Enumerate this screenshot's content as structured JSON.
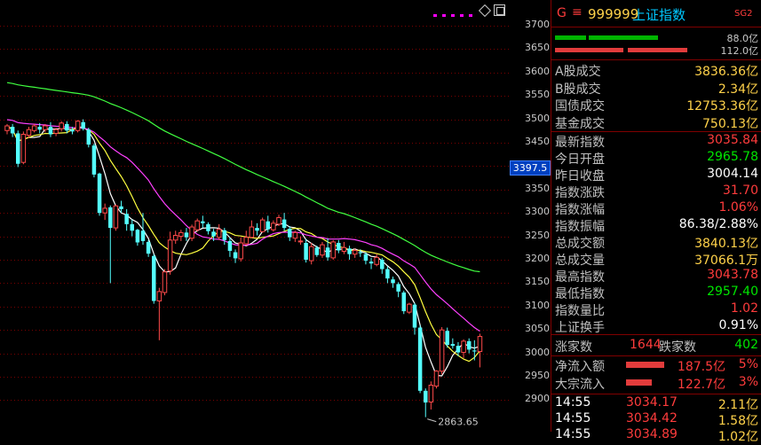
{
  "chart_data": {
    "type": "candlestick",
    "ylim": [
      2850,
      3720
    ],
    "price_ticks": [
      "3700",
      "3650",
      "3600",
      "3550",
      "3500",
      "3450",
      "3400",
      "3350",
      "3300",
      "3250",
      "3200",
      "3150",
      "3100",
      "3050",
      "3000",
      "2950",
      "2900"
    ],
    "current_price_label": "3397.5",
    "low_annotation": "2863.65",
    "candles": [
      [
        3476,
        3486,
        3468,
        3490
      ],
      [
        3484,
        3470,
        3462,
        3490
      ],
      [
        3470,
        3405,
        3398,
        3476
      ],
      [
        3408,
        3468,
        3404,
        3474
      ],
      [
        3466,
        3478,
        3460,
        3484
      ],
      [
        3476,
        3486,
        3472,
        3490
      ],
      [
        3484,
        3478,
        3470,
        3492
      ],
      [
        3478,
        3486,
        3472,
        3490
      ],
      [
        3484,
        3468,
        3462,
        3494
      ],
      [
        3470,
        3478,
        3464,
        3482
      ],
      [
        3480,
        3492,
        3474,
        3496
      ],
      [
        3490,
        3476,
        3470,
        3496
      ],
      [
        3478,
        3474,
        3468,
        3484
      ],
      [
        3476,
        3496,
        3472,
        3498
      ],
      [
        3494,
        3480,
        3476,
        3500
      ],
      [
        3478,
        3446,
        3440,
        3482
      ],
      [
        3444,
        3382,
        3376,
        3448
      ],
      [
        3384,
        3300,
        3294,
        3386
      ],
      [
        3300,
        3310,
        3285,
        3320
      ],
      [
        3312,
        3268,
        3150,
        3316
      ],
      [
        3268,
        3315,
        3262,
        3318
      ],
      [
        3314,
        3308,
        3300,
        3326
      ],
      [
        3298,
        3276,
        3262,
        3308
      ],
      [
        3276,
        3262,
        3250,
        3286
      ],
      [
        3264,
        3237,
        3230,
        3266
      ],
      [
        3262,
        3240,
        3232,
        3300
      ],
      [
        3238,
        3213,
        3206,
        3242
      ],
      [
        3208,
        3112,
        3106,
        3212
      ],
      [
        3112,
        3132,
        3028,
        3140
      ],
      [
        3130,
        3174,
        3124,
        3180
      ],
      [
        3176,
        3242,
        3168,
        3260
      ],
      [
        3242,
        3252,
        3234,
        3262
      ],
      [
        3250,
        3258,
        3240,
        3264
      ],
      [
        3258,
        3248,
        3240,
        3268
      ],
      [
        3246,
        3270,
        3240,
        3275
      ],
      [
        3264,
        3283,
        3260,
        3288
      ],
      [
        3282,
        3278,
        3268,
        3294
      ],
      [
        3276,
        3261,
        3254,
        3280
      ],
      [
        3260,
        3250,
        3240,
        3266
      ],
      [
        3248,
        3265,
        3242,
        3276
      ],
      [
        3263,
        3242,
        3232,
        3268
      ],
      [
        3240,
        3219,
        3206,
        3248
      ],
      [
        3216,
        3203,
        3193,
        3222
      ],
      [
        3202,
        3236,
        3196,
        3248
      ],
      [
        3234,
        3248,
        3230,
        3262
      ],
      [
        3248,
        3270,
        3246,
        3284
      ],
      [
        3268,
        3262,
        3252,
        3278
      ],
      [
        3260,
        3285,
        3258,
        3290
      ],
      [
        3282,
        3265,
        3258,
        3294
      ],
      [
        3264,
        3278,
        3260,
        3284
      ],
      [
        3276,
        3290,
        3272,
        3296
      ],
      [
        3286,
        3268,
        3262,
        3300
      ],
      [
        3266,
        3248,
        3240,
        3272
      ],
      [
        3246,
        3258,
        3238,
        3262
      ],
      [
        3240,
        3240,
        3232,
        3250
      ],
      [
        3236,
        3200,
        3194,
        3244
      ],
      [
        3198,
        3228,
        3190,
        3236
      ],
      [
        3226,
        3210,
        3206,
        3230
      ],
      [
        3210,
        3232,
        3204,
        3238
      ],
      [
        3226,
        3205,
        3198,
        3246
      ],
      [
        3204,
        3238,
        3200,
        3242
      ],
      [
        3236,
        3220,
        3214,
        3242
      ],
      [
        3218,
        3226,
        3212,
        3238
      ],
      [
        3224,
        3212,
        3200,
        3230
      ],
      [
        3212,
        3220,
        3204,
        3224
      ],
      [
        3216,
        3214,
        3206,
        3222
      ],
      [
        3212,
        3198,
        3190,
        3216
      ],
      [
        3196,
        3192,
        3180,
        3204
      ],
      [
        3190,
        3205,
        3186,
        3212
      ],
      [
        3200,
        3180,
        3170,
        3204
      ],
      [
        3180,
        3160,
        3150,
        3186
      ],
      [
        3158,
        3150,
        3140,
        3164
      ],
      [
        3148,
        3132,
        3120,
        3152
      ],
      [
        3130,
        3090,
        3084,
        3134
      ],
      [
        3088,
        3105,
        3084,
        3108
      ],
      [
        3104,
        3055,
        3040,
        3108
      ],
      [
        3055,
        2920,
        2915,
        3060
      ],
      [
        2920,
        2895,
        2863.65,
        2925
      ],
      [
        2896,
        2932,
        2880,
        2940
      ],
      [
        2930,
        2962,
        2925,
        2964
      ],
      [
        2962,
        3050,
        2955,
        3056
      ],
      [
        3048,
        3018,
        3012,
        3055
      ],
      [
        3020,
        3016,
        3010,
        3032
      ],
      [
        3016,
        3002,
        2994,
        3024
      ],
      [
        3002,
        3026,
        2990,
        3030
      ],
      [
        3026,
        3008,
        3000,
        3032
      ],
      [
        3006,
        3004,
        2985,
        3028
      ],
      [
        3004,
        3036,
        2970,
        3042
      ]
    ]
  },
  "header": {
    "code_prefix": "G",
    "menu_glyph": "≡",
    "code": "999999",
    "name": "上证指数",
    "tag": "SG2"
  },
  "bars": {
    "top_value": "88.0亿",
    "bottom_value": "112.0亿",
    "top_color": "#00b400",
    "bottom_color": "#e23c3c"
  },
  "volume_rows": [
    {
      "label": "A股成交",
      "value": "3836.36亿"
    },
    {
      "label": "B股成交",
      "value": "2.34亿"
    },
    {
      "label": "国债成交",
      "value": "12753.36亿"
    },
    {
      "label": "基金成交",
      "value": "750.13亿"
    }
  ],
  "quote_rows": [
    {
      "label": "最新指数",
      "value": "3035.84",
      "tone": "red"
    },
    {
      "label": "今日开盘",
      "value": "2965.78",
      "tone": "green"
    },
    {
      "label": "昨日收盘",
      "value": "3004.14",
      "tone": "white"
    },
    {
      "label": "指数涨跌",
      "value": "31.70",
      "tone": "red"
    },
    {
      "label": "指数涨幅",
      "value": "1.06%",
      "tone": "red"
    },
    {
      "label": "指数振幅",
      "value": "86.38/2.88%",
      "tone": "white"
    },
    {
      "label": "总成交额",
      "value": "3840.13亿",
      "tone": "yellow"
    },
    {
      "label": "总成交量",
      "value": "37066.1万",
      "tone": "yellow"
    },
    {
      "label": "最高指数",
      "value": "3043.78",
      "tone": "red"
    },
    {
      "label": "最低指数",
      "value": "2957.40",
      "tone": "green"
    },
    {
      "label": "指数量比",
      "value": "1.02",
      "tone": "red"
    },
    {
      "label": "上证换手",
      "value": "0.91%",
      "tone": "white"
    }
  ],
  "breadth": {
    "up_label": "涨家数",
    "up_value": "1644",
    "down_label": "跌家数",
    "down_value": "402"
  },
  "flows": [
    {
      "label": "净流入额",
      "amount": "187.5亿",
      "pct": "5%",
      "bar_fraction": 0.82
    },
    {
      "label": "大宗流入",
      "amount": "122.7亿",
      "pct": "3%",
      "bar_fraction": 0.55
    }
  ],
  "ticks": [
    {
      "time": "14:55",
      "price": "3034.17",
      "volume": "2.11亿"
    },
    {
      "time": "14:55",
      "price": "3034.42",
      "volume": "1.58亿"
    },
    {
      "time": "14:55",
      "price": "3034.89",
      "volume": "1.02亿"
    }
  ]
}
